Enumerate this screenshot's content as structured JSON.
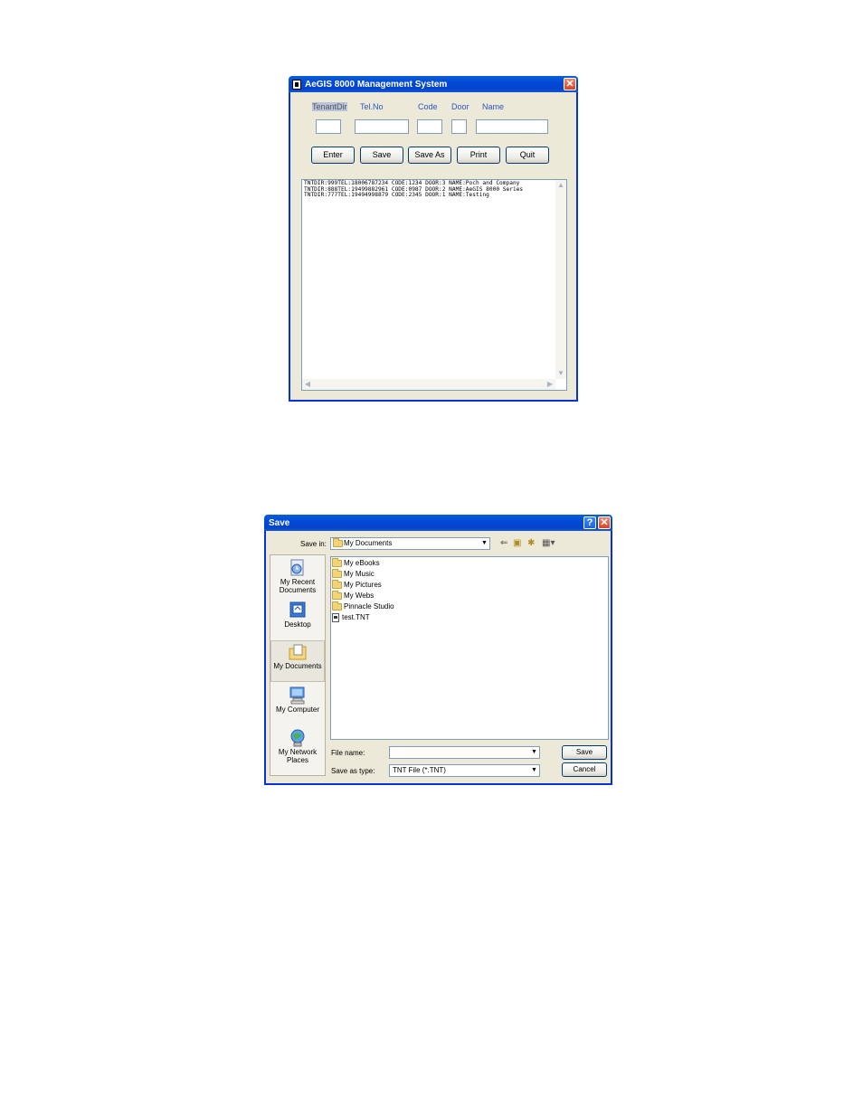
{
  "mgmt_window": {
    "title": "AeGIS 8000 Management System",
    "close_glyph": "✕",
    "labels": {
      "tenantdir": "TenantDir",
      "telno": "Tel.No",
      "code": "Code",
      "door": "Door",
      "name": "Name"
    },
    "buttons": {
      "enter": "Enter",
      "save": "Save",
      "save_as": "Save As",
      "print": "Print",
      "quit": "Quit"
    },
    "memo_lines": [
      "TNTDIR:999TEL:18006787234 CODE:1234 DOOR:3 NAME:Poch and Company",
      "TNTDIR:888TEL:19499882961 CODE:0987 DOOR:2 NAME:AeGIS 8000 Series",
      "TNTDIR:777TEL:19494998879 CODE:2345 DOOR:1 NAME:Testing"
    ]
  },
  "save_dialog": {
    "title": "Save",
    "help_glyph": "?",
    "close_glyph": "✕",
    "save_in_label": "Save in:",
    "save_in_value": "My Documents",
    "places": [
      {
        "label_line1": "My Recent",
        "label_line2": "Documents",
        "icon": "recent-documents-icon"
      },
      {
        "label_line1": "Desktop",
        "label_line2": "",
        "icon": "desktop-icon"
      },
      {
        "label_line1": "My Documents",
        "label_line2": "",
        "icon": "my-documents-icon"
      },
      {
        "label_line1": "My Computer",
        "label_line2": "",
        "icon": "my-computer-icon"
      },
      {
        "label_line1": "My Network",
        "label_line2": "Places",
        "icon": "network-places-icon"
      }
    ],
    "files": [
      {
        "name": "My eBooks",
        "type": "folder"
      },
      {
        "name": "My Music",
        "type": "folder"
      },
      {
        "name": "My Pictures",
        "type": "folder"
      },
      {
        "name": "My Webs",
        "type": "folder"
      },
      {
        "name": "Pinnacle Studio",
        "type": "folder"
      },
      {
        "name": "test.TNT",
        "type": "file"
      }
    ],
    "file_name_label": "File name:",
    "file_name_value": "",
    "save_as_type_label": "Save as type:",
    "save_as_type_value": "TNT File (*.TNT)",
    "save_button": "Save",
    "cancel_button": "Cancel"
  }
}
